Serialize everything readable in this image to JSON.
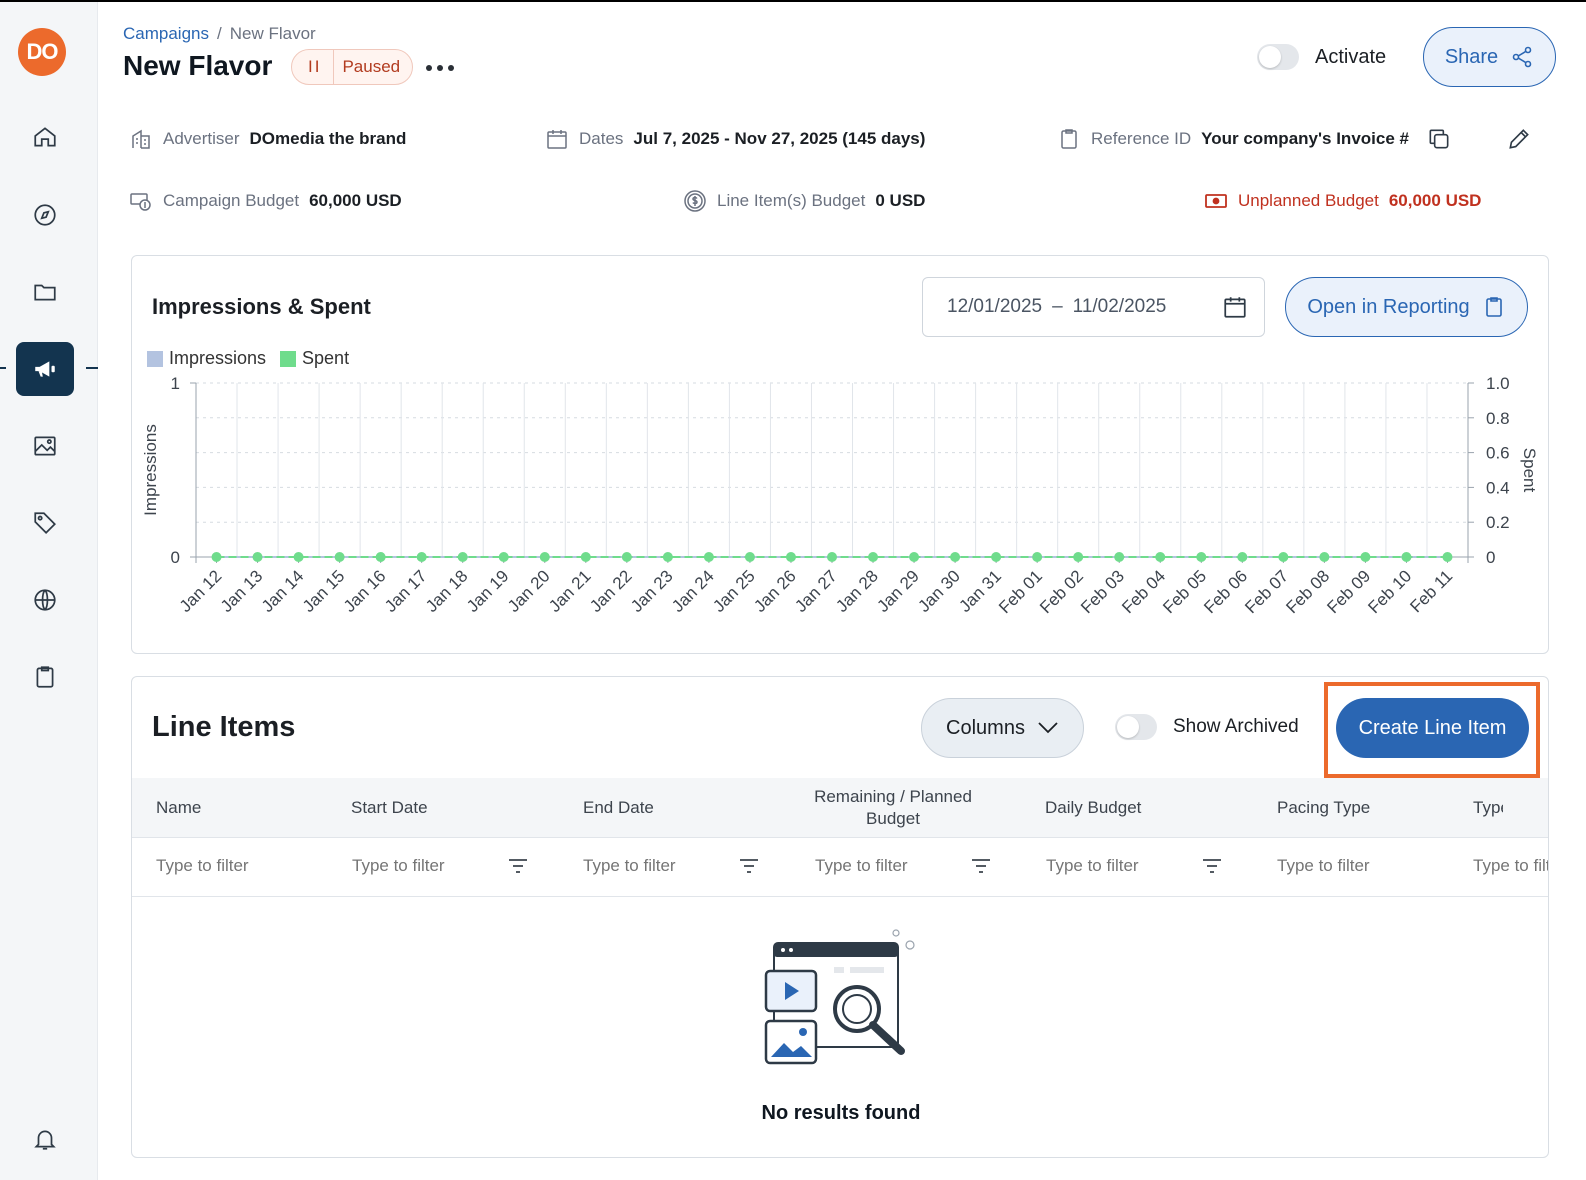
{
  "user": {
    "avatar_initials": "DO",
    "avatar_color": "#ec6a2c"
  },
  "sidebar": {
    "items": [
      {
        "icon": "home-icon"
      },
      {
        "icon": "compass-icon"
      },
      {
        "icon": "folder-icon"
      },
      {
        "icon": "megaphone-icon",
        "active": true
      },
      {
        "icon": "image-icon"
      },
      {
        "icon": "tag-icon"
      },
      {
        "icon": "globe-icon"
      },
      {
        "icon": "clipboard-icon"
      }
    ],
    "bottom_icon": "bell-icon"
  },
  "breadcrumb": {
    "parent": "Campaigns",
    "separator": "/",
    "current": "New Flavor"
  },
  "header": {
    "title": "New Flavor",
    "status": "Paused",
    "status_icon": "II",
    "activate_label": "Activate",
    "share_label": "Share"
  },
  "info": {
    "advertiser_label": "Advertiser",
    "advertiser_value": "DOmedia the brand",
    "dates_label": "Dates",
    "dates_value": "Jul 7, 2025 - Nov 27, 2025 (145 days)",
    "reference_label": "Reference ID",
    "reference_value": "Your company's Invoice #",
    "campaign_budget_label": "Campaign Budget",
    "campaign_budget_value": "60,000 USD",
    "line_items_budget_label": "Line Item(s) Budget",
    "line_items_budget_value": "0 USD",
    "unplanned_budget_label": "Unplanned Budget",
    "unplanned_budget_value": "60,000 USD"
  },
  "chart_panel": {
    "title": "Impressions & Spent",
    "date_from": "12/01/2025",
    "date_sep": "–",
    "date_to": "11/02/2025",
    "open_reporting_label": "Open in Reporting"
  },
  "chart_data": {
    "type": "line",
    "categories": [
      "Jan 12",
      "Jan 13",
      "Jan 14",
      "Jan 15",
      "Jan 16",
      "Jan 17",
      "Jan 18",
      "Jan 19",
      "Jan 20",
      "Jan 21",
      "Jan 22",
      "Jan 23",
      "Jan 24",
      "Jan 25",
      "Jan 26",
      "Jan 27",
      "Jan 28",
      "Jan 29",
      "Jan 30",
      "Jan 31",
      "Feb 01",
      "Feb 02",
      "Feb 03",
      "Feb 04",
      "Feb 05",
      "Feb 06",
      "Feb 07",
      "Feb 08",
      "Feb 09",
      "Feb 10",
      "Feb 11"
    ],
    "series": [
      {
        "name": "Impressions",
        "color": "#b3c3e0",
        "axis": "left",
        "values": [
          0,
          0,
          0,
          0,
          0,
          0,
          0,
          0,
          0,
          0,
          0,
          0,
          0,
          0,
          0,
          0,
          0,
          0,
          0,
          0,
          0,
          0,
          0,
          0,
          0,
          0,
          0,
          0,
          0,
          0,
          0
        ]
      },
      {
        "name": "Spent",
        "color": "#6fdc8c",
        "axis": "right",
        "values": [
          0,
          0,
          0,
          0,
          0,
          0,
          0,
          0,
          0,
          0,
          0,
          0,
          0,
          0,
          0,
          0,
          0,
          0,
          0,
          0,
          0,
          0,
          0,
          0,
          0,
          0,
          0,
          0,
          0,
          0,
          0
        ]
      }
    ],
    "ylabel": "Impressions",
    "y2label": "Spent",
    "ylim": [
      0,
      1
    ],
    "yticks": [
      "0",
      "1"
    ],
    "y2lim": [
      0,
      1.0
    ],
    "y2ticks": [
      "0",
      "0.2",
      "0.4",
      "0.6",
      "0.8",
      "1.0"
    ],
    "grid": true,
    "legend": "top-left"
  },
  "line_items": {
    "title": "Line Items",
    "columns_label": "Columns",
    "show_archived_label": "Show Archived",
    "create_label": "Create Line Item",
    "headers": [
      "Name",
      "Start Date",
      "End Date",
      "Remaining / Planned Budget",
      "Daily Budget",
      "Pacing Type",
      "Type"
    ],
    "filter_placeholder": "Type to filter",
    "empty_message": "No results found"
  }
}
